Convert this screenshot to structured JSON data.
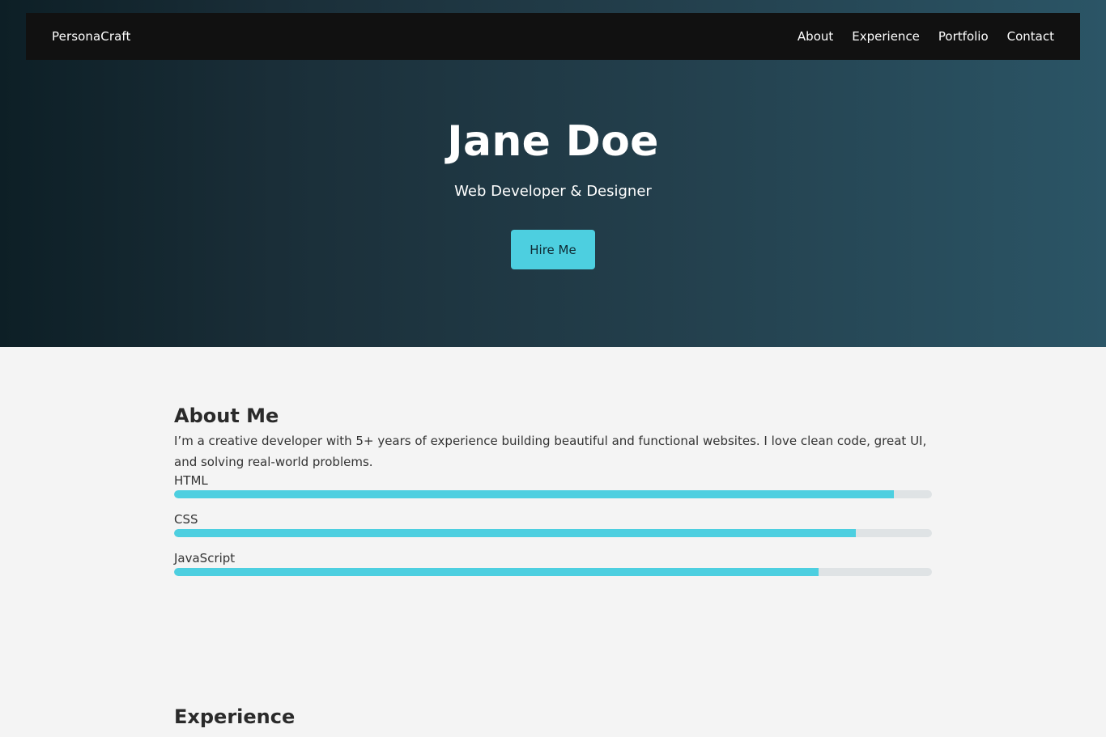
{
  "navbar": {
    "brand": "PersonaCraft",
    "links": [
      {
        "label": "About"
      },
      {
        "label": "Experience"
      },
      {
        "label": "Portfolio"
      },
      {
        "label": "Contact"
      }
    ]
  },
  "hero": {
    "title": "Jane Doe",
    "subtitle": "Web Developer & Designer",
    "cta_label": "Hire Me"
  },
  "about": {
    "title": "About Me",
    "text": "I’m a creative developer with 5+ years of experience building beautiful and functional websites. I love clean code, great UI, and solving real-world problems.",
    "skills": [
      {
        "name": "HTML",
        "level_percent": 95
      },
      {
        "name": "CSS",
        "level_percent": 90
      },
      {
        "name": "JavaScript",
        "level_percent": 85
      }
    ]
  },
  "experience": {
    "title": "Experience"
  },
  "colors": {
    "accent": "#4dcfe0",
    "navbar_bg": "#111111",
    "page_bg": "#f4f4f4",
    "track_bg": "#dfe3e5"
  }
}
